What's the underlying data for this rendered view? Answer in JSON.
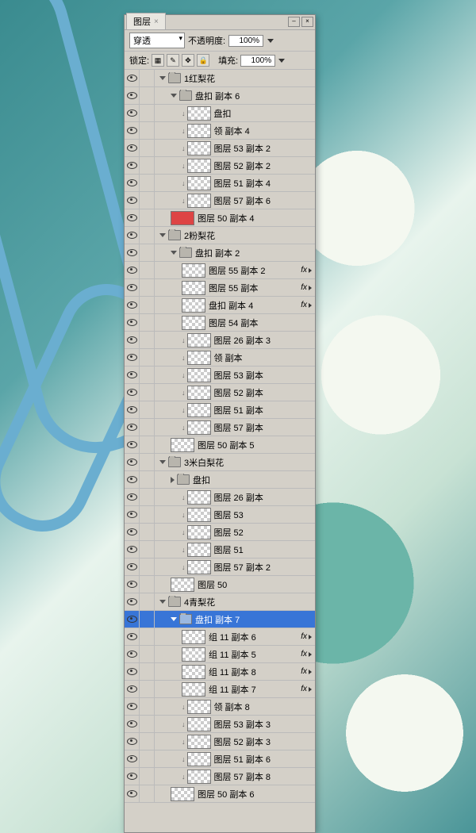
{
  "panel": {
    "tab": "图层",
    "blend": "穿透",
    "opacityLabel": "不透明度:",
    "opacity": "100%",
    "lockLabel": "锁定:",
    "fillLabel": "填充:",
    "fill": "100%",
    "fxLabel": "fx"
  },
  "layers": [
    {
      "t": "g",
      "d": 0,
      "o": 1,
      "n": "1红梨花"
    },
    {
      "t": "g",
      "d": 1,
      "o": 1,
      "n": "盘扣 副本 6"
    },
    {
      "t": "l",
      "d": 2,
      "c": 1,
      "n": "盘扣"
    },
    {
      "t": "l",
      "d": 2,
      "c": 1,
      "n": "领 副本 4"
    },
    {
      "t": "l",
      "d": 2,
      "c": 1,
      "n": "图层 53 副本 2"
    },
    {
      "t": "l",
      "d": 2,
      "c": 1,
      "n": "图层 52 副本 2"
    },
    {
      "t": "l",
      "d": 2,
      "c": 1,
      "n": "图层 51 副本 4"
    },
    {
      "t": "l",
      "d": 2,
      "c": 1,
      "n": "图层 57 副本 6"
    },
    {
      "t": "l",
      "d": 1,
      "red": 1,
      "n": "图层 50 副本 4"
    },
    {
      "t": "g",
      "d": 0,
      "o": 1,
      "n": "2粉梨花"
    },
    {
      "t": "g",
      "d": 1,
      "o": 1,
      "n": "盘扣 副本 2"
    },
    {
      "t": "l",
      "d": 2,
      "n": "图层 55 副本 2",
      "fx": 1
    },
    {
      "t": "l",
      "d": 2,
      "n": "图层 55 副本",
      "fx": 1
    },
    {
      "t": "l",
      "d": 2,
      "n": "盘扣 副本 4",
      "fx": 1
    },
    {
      "t": "l",
      "d": 2,
      "n": "图层 54 副本"
    },
    {
      "t": "l",
      "d": 2,
      "c": 1,
      "n": "图层 26 副本 3"
    },
    {
      "t": "l",
      "d": 2,
      "c": 1,
      "n": "领 副本"
    },
    {
      "t": "l",
      "d": 2,
      "c": 1,
      "n": "图层 53 副本"
    },
    {
      "t": "l",
      "d": 2,
      "c": 1,
      "n": "图层 52 副本"
    },
    {
      "t": "l",
      "d": 2,
      "c": 1,
      "n": "图层 51 副本"
    },
    {
      "t": "l",
      "d": 2,
      "c": 1,
      "n": "图层 57 副本"
    },
    {
      "t": "l",
      "d": 1,
      "n": "图层 50 副本 5"
    },
    {
      "t": "g",
      "d": 0,
      "o": 1,
      "n": "3米白梨花"
    },
    {
      "t": "g",
      "d": 1,
      "o": 0,
      "n": "盘扣"
    },
    {
      "t": "l",
      "d": 2,
      "c": 1,
      "n": "图层 26 副本"
    },
    {
      "t": "l",
      "d": 2,
      "c": 1,
      "n": "图层 53"
    },
    {
      "t": "l",
      "d": 2,
      "c": 1,
      "n": "图层 52"
    },
    {
      "t": "l",
      "d": 2,
      "c": 1,
      "n": "图层 51"
    },
    {
      "t": "l",
      "d": 2,
      "c": 1,
      "n": "图层 57 副本 2"
    },
    {
      "t": "l",
      "d": 1,
      "n": "图层 50"
    },
    {
      "t": "g",
      "d": 0,
      "o": 1,
      "n": "4青梨花"
    },
    {
      "t": "g",
      "d": 1,
      "o": 1,
      "n": "盘扣 副本 7",
      "sel": 1
    },
    {
      "t": "l",
      "d": 2,
      "n": "组 11 副本 6",
      "fx": 1
    },
    {
      "t": "l",
      "d": 2,
      "n": "组 11 副本 5",
      "fx": 1
    },
    {
      "t": "l",
      "d": 2,
      "n": "组 11 副本 8",
      "fx": 1
    },
    {
      "t": "l",
      "d": 2,
      "n": "组 11 副本 7",
      "fx": 1
    },
    {
      "t": "l",
      "d": 2,
      "c": 1,
      "n": "领 副本 8"
    },
    {
      "t": "l",
      "d": 2,
      "c": 1,
      "n": "图层 53 副本 3"
    },
    {
      "t": "l",
      "d": 2,
      "c": 1,
      "n": "图层 52 副本 3"
    },
    {
      "t": "l",
      "d": 2,
      "c": 1,
      "n": "图层 51 副本 6"
    },
    {
      "t": "l",
      "d": 2,
      "c": 1,
      "n": "图层 57 副本 8"
    },
    {
      "t": "l",
      "d": 1,
      "n": "图层 50 副本 6"
    }
  ]
}
